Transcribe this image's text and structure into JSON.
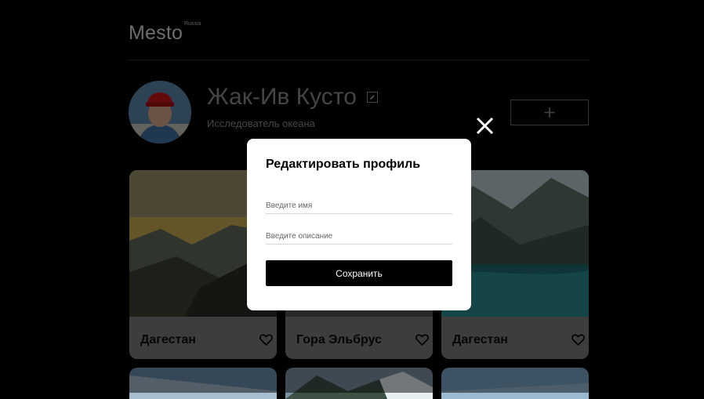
{
  "header": {
    "logo": "Mesto",
    "logo_sup": "Russia"
  },
  "profile": {
    "name": "Жак-Ив Кусто",
    "about": "Исследователь океана"
  },
  "cards": [
    {
      "title": "Дагестан"
    },
    {
      "title": "Гора Эльбрус"
    },
    {
      "title": "Дагестан"
    }
  ],
  "popup": {
    "title": "Редактировать профиль",
    "name_placeholder": "Введите имя",
    "about_placeholder": "Введите описание",
    "save_label": "Сохранить"
  },
  "icons": {
    "close": "close-icon",
    "edit": "edit-icon",
    "add": "plus-icon",
    "like": "heart-icon"
  },
  "colors": {
    "background": "#000000",
    "popup": "#ffffff",
    "save_button": "#000000"
  }
}
